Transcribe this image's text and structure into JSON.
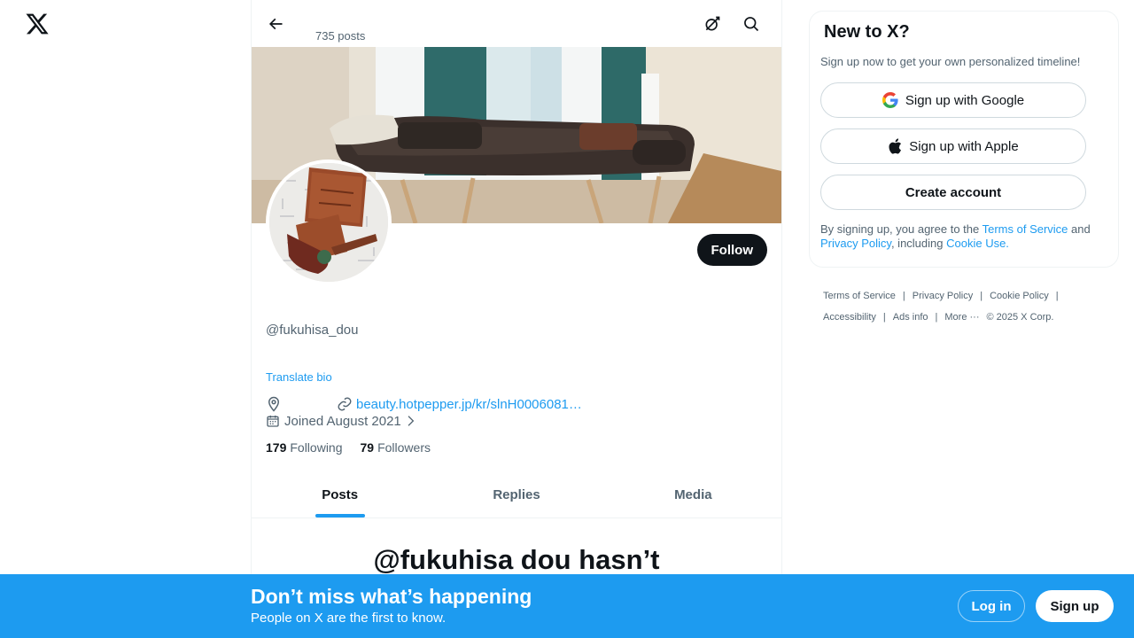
{
  "header": {
    "post_count": "735 posts"
  },
  "profile": {
    "follow_label": "Follow",
    "handle": "@fukuhisa_dou",
    "translate_label": "Translate bio",
    "website": "beauty.hotpepper.jp/kr/slnH0006081…",
    "joined": "Joined August 2021",
    "following_count": "179",
    "following_label": "Following",
    "followers_count": "79",
    "followers_label": "Followers"
  },
  "tabs": [
    {
      "label": "Posts",
      "active": true
    },
    {
      "label": "Replies",
      "active": false
    },
    {
      "label": "Media",
      "active": false
    }
  ],
  "empty_state": {
    "title": "@fukuhisa dou hasn’t"
  },
  "signup_panel": {
    "title": "New to X?",
    "subtitle": "Sign up now to get your own personalized timeline!",
    "google_label": "Sign up with Google",
    "apple_label": "Sign up with Apple",
    "create_label": "Create account",
    "legal_prefix": "By signing up, you agree to the ",
    "terms_link": "Terms of Service",
    "legal_and": " and ",
    "privacy_link": "Privacy Policy",
    "legal_including": ", including ",
    "cookie_link": "Cookie Use."
  },
  "footer": {
    "terms": "Terms of Service",
    "privacy": "Privacy Policy",
    "cookie": "Cookie Policy",
    "accessibility": "Accessibility",
    "ads": "Ads info",
    "more": "More ···",
    "copyright": "© 2025 X Corp."
  },
  "bottom_bar": {
    "title": "Don’t miss what’s happening",
    "subtitle": "People on X are the first to know.",
    "login_label": "Log in",
    "signup_label": "Sign up"
  },
  "colors": {
    "accent": "#1d9bf0",
    "text_primary": "#0f1419",
    "text_secondary": "#536471",
    "border": "#eff3f4"
  }
}
